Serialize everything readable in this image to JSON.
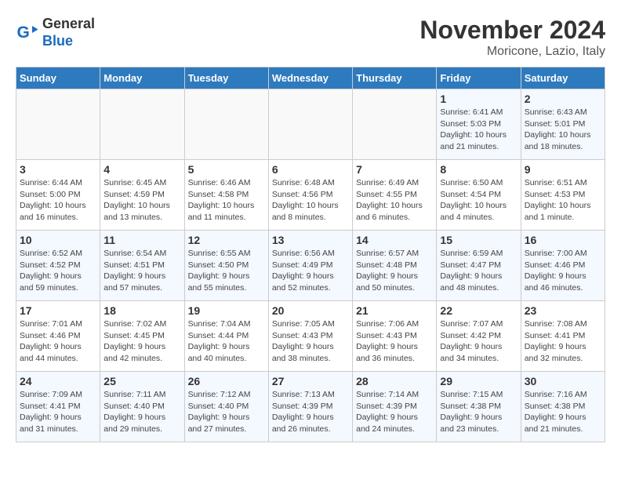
{
  "header": {
    "logo_line1": "General",
    "logo_line2": "Blue",
    "month": "November 2024",
    "location": "Moricone, Lazio, Italy"
  },
  "weekdays": [
    "Sunday",
    "Monday",
    "Tuesday",
    "Wednesday",
    "Thursday",
    "Friday",
    "Saturday"
  ],
  "weeks": [
    [
      {
        "day": "",
        "info": ""
      },
      {
        "day": "",
        "info": ""
      },
      {
        "day": "",
        "info": ""
      },
      {
        "day": "",
        "info": ""
      },
      {
        "day": "",
        "info": ""
      },
      {
        "day": "1",
        "info": "Sunrise: 6:41 AM\nSunset: 5:03 PM\nDaylight: 10 hours\nand 21 minutes."
      },
      {
        "day": "2",
        "info": "Sunrise: 6:43 AM\nSunset: 5:01 PM\nDaylight: 10 hours\nand 18 minutes."
      }
    ],
    [
      {
        "day": "3",
        "info": "Sunrise: 6:44 AM\nSunset: 5:00 PM\nDaylight: 10 hours\nand 16 minutes."
      },
      {
        "day": "4",
        "info": "Sunrise: 6:45 AM\nSunset: 4:59 PM\nDaylight: 10 hours\nand 13 minutes."
      },
      {
        "day": "5",
        "info": "Sunrise: 6:46 AM\nSunset: 4:58 PM\nDaylight: 10 hours\nand 11 minutes."
      },
      {
        "day": "6",
        "info": "Sunrise: 6:48 AM\nSunset: 4:56 PM\nDaylight: 10 hours\nand 8 minutes."
      },
      {
        "day": "7",
        "info": "Sunrise: 6:49 AM\nSunset: 4:55 PM\nDaylight: 10 hours\nand 6 minutes."
      },
      {
        "day": "8",
        "info": "Sunrise: 6:50 AM\nSunset: 4:54 PM\nDaylight: 10 hours\nand 4 minutes."
      },
      {
        "day": "9",
        "info": "Sunrise: 6:51 AM\nSunset: 4:53 PM\nDaylight: 10 hours\nand 1 minute."
      }
    ],
    [
      {
        "day": "10",
        "info": "Sunrise: 6:52 AM\nSunset: 4:52 PM\nDaylight: 9 hours\nand 59 minutes."
      },
      {
        "day": "11",
        "info": "Sunrise: 6:54 AM\nSunset: 4:51 PM\nDaylight: 9 hours\nand 57 minutes."
      },
      {
        "day": "12",
        "info": "Sunrise: 6:55 AM\nSunset: 4:50 PM\nDaylight: 9 hours\nand 55 minutes."
      },
      {
        "day": "13",
        "info": "Sunrise: 6:56 AM\nSunset: 4:49 PM\nDaylight: 9 hours\nand 52 minutes."
      },
      {
        "day": "14",
        "info": "Sunrise: 6:57 AM\nSunset: 4:48 PM\nDaylight: 9 hours\nand 50 minutes."
      },
      {
        "day": "15",
        "info": "Sunrise: 6:59 AM\nSunset: 4:47 PM\nDaylight: 9 hours\nand 48 minutes."
      },
      {
        "day": "16",
        "info": "Sunrise: 7:00 AM\nSunset: 4:46 PM\nDaylight: 9 hours\nand 46 minutes."
      }
    ],
    [
      {
        "day": "17",
        "info": "Sunrise: 7:01 AM\nSunset: 4:46 PM\nDaylight: 9 hours\nand 44 minutes."
      },
      {
        "day": "18",
        "info": "Sunrise: 7:02 AM\nSunset: 4:45 PM\nDaylight: 9 hours\nand 42 minutes."
      },
      {
        "day": "19",
        "info": "Sunrise: 7:04 AM\nSunset: 4:44 PM\nDaylight: 9 hours\nand 40 minutes."
      },
      {
        "day": "20",
        "info": "Sunrise: 7:05 AM\nSunset: 4:43 PM\nDaylight: 9 hours\nand 38 minutes."
      },
      {
        "day": "21",
        "info": "Sunrise: 7:06 AM\nSunset: 4:43 PM\nDaylight: 9 hours\nand 36 minutes."
      },
      {
        "day": "22",
        "info": "Sunrise: 7:07 AM\nSunset: 4:42 PM\nDaylight: 9 hours\nand 34 minutes."
      },
      {
        "day": "23",
        "info": "Sunrise: 7:08 AM\nSunset: 4:41 PM\nDaylight: 9 hours\nand 32 minutes."
      }
    ],
    [
      {
        "day": "24",
        "info": "Sunrise: 7:09 AM\nSunset: 4:41 PM\nDaylight: 9 hours\nand 31 minutes."
      },
      {
        "day": "25",
        "info": "Sunrise: 7:11 AM\nSunset: 4:40 PM\nDaylight: 9 hours\nand 29 minutes."
      },
      {
        "day": "26",
        "info": "Sunrise: 7:12 AM\nSunset: 4:40 PM\nDaylight: 9 hours\nand 27 minutes."
      },
      {
        "day": "27",
        "info": "Sunrise: 7:13 AM\nSunset: 4:39 PM\nDaylight: 9 hours\nand 26 minutes."
      },
      {
        "day": "28",
        "info": "Sunrise: 7:14 AM\nSunset: 4:39 PM\nDaylight: 9 hours\nand 24 minutes."
      },
      {
        "day": "29",
        "info": "Sunrise: 7:15 AM\nSunset: 4:38 PM\nDaylight: 9 hours\nand 23 minutes."
      },
      {
        "day": "30",
        "info": "Sunrise: 7:16 AM\nSunset: 4:38 PM\nDaylight: 9 hours\nand 21 minutes."
      }
    ]
  ]
}
